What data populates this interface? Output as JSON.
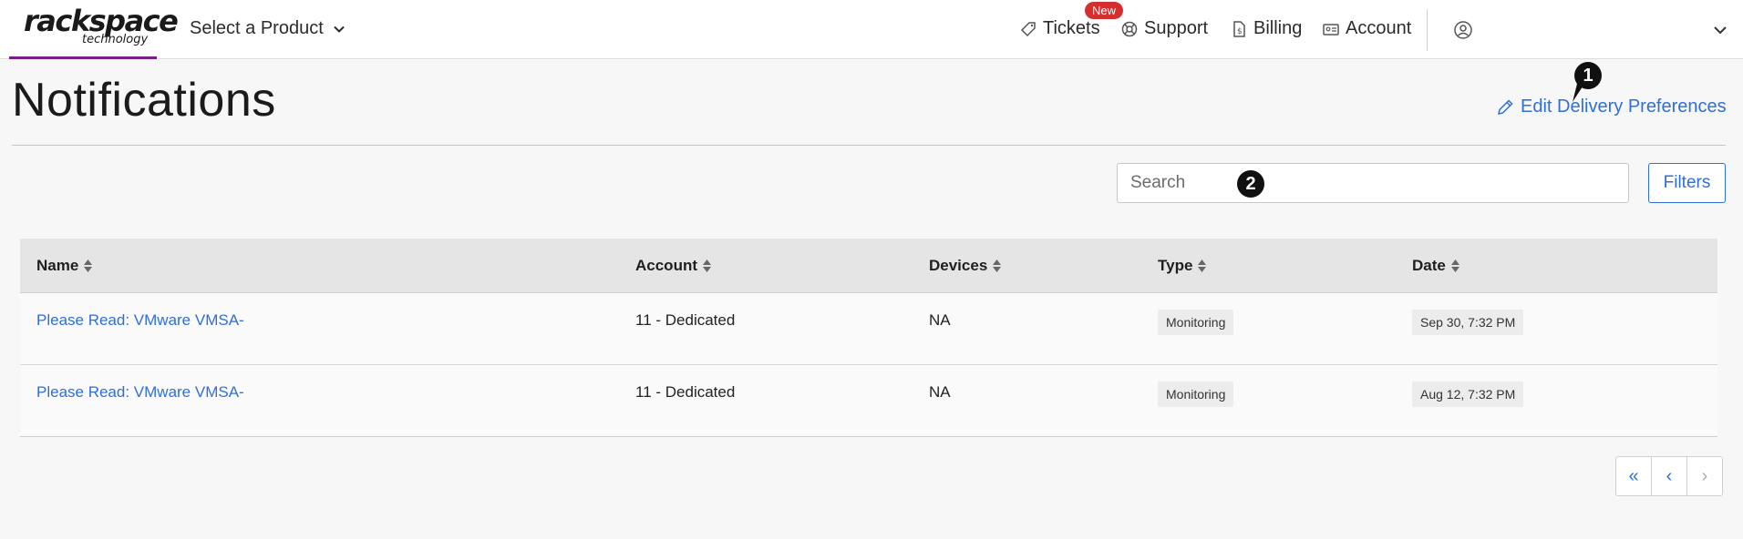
{
  "header": {
    "logo_main": "rackspace",
    "logo_sub": "technology",
    "product_select": "Select a Product",
    "nav": {
      "tickets": "Tickets",
      "tickets_badge": "New",
      "support": "Support",
      "billing": "Billing",
      "account": "Account"
    }
  },
  "page": {
    "title": "Notifications",
    "edit_preferences": "Edit Delivery Preferences",
    "marker_1": "1",
    "marker_2": "2"
  },
  "search": {
    "placeholder": "Search"
  },
  "filters_label": "Filters",
  "table": {
    "columns": {
      "name": "Name",
      "account": "Account",
      "devices": "Devices",
      "type": "Type",
      "date": "Date"
    },
    "rows": [
      {
        "name": "Please Read: VMware VMSA-",
        "account": "11 - Dedicated",
        "devices": "NA",
        "type": "Monitoring",
        "date": "Sep 30, 7:32 PM"
      },
      {
        "name": "Please Read: VMware VMSA-",
        "account": "11 - Dedicated",
        "devices": "NA",
        "type": "Monitoring",
        "date": "Aug 12, 7:32 PM"
      }
    ]
  },
  "pagination": {
    "first": "«",
    "prev": "‹",
    "next": "›"
  },
  "colors": {
    "accent": "#2f6fd6",
    "brand_underline": "#7a1f8b",
    "badge": "#d32f2f"
  }
}
